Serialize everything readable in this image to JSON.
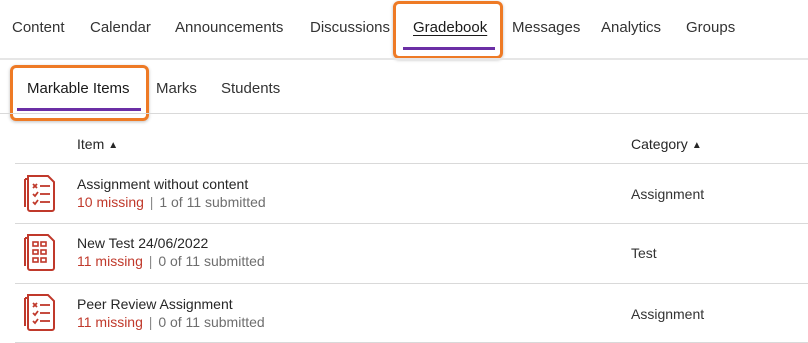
{
  "nav": {
    "items": [
      "Content",
      "Calendar",
      "Announcements",
      "Discussions",
      "Gradebook",
      "Messages",
      "Analytics",
      "Groups"
    ],
    "active": "Gradebook"
  },
  "subtabs": {
    "items": [
      "Markable Items",
      "Marks",
      "Students"
    ],
    "active": "Markable Items"
  },
  "table": {
    "headers": {
      "item": "Item",
      "category": "Category"
    },
    "rows": [
      {
        "title": "Assignment without content",
        "missing": "10 missing",
        "submitted": "1 of 11 submitted",
        "category": "Assignment",
        "icon": "assignment-icon"
      },
      {
        "title": "New Test 24/06/2022",
        "missing": "11 missing",
        "submitted": "0 of 11 submitted",
        "category": "Test",
        "icon": "test-icon"
      },
      {
        "title": "Peer Review Assignment",
        "missing": "11 missing",
        "submitted": "0 of 11 submitted",
        "category": "Assignment",
        "icon": "assignment-icon"
      }
    ]
  },
  "colors": {
    "accent": "#6b2fa5",
    "highlight": "#ee7a25",
    "missing": "#c0392b",
    "icon": "#c0392b"
  }
}
